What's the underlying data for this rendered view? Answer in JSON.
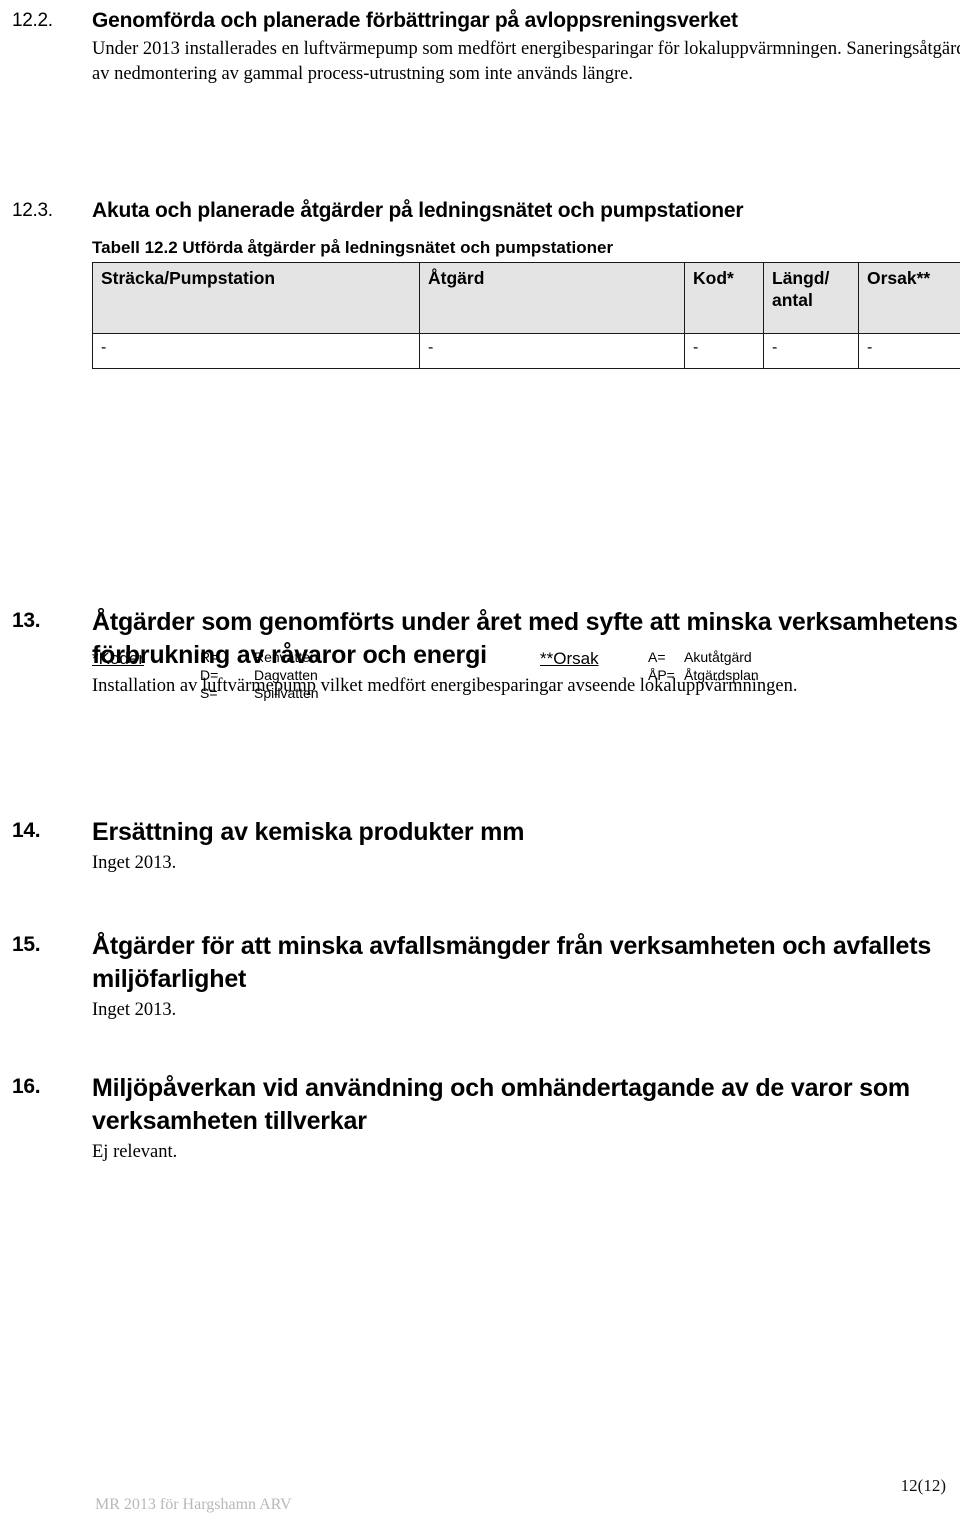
{
  "document": {
    "sections": [
      {
        "number": "12.2.",
        "title": "Genomförda och planerade förbättringar på avloppsreningsverket",
        "body": "Under 2013 installerades en luftvärmepump som medfört energibesparingar för lokaluppvärmningen. Saneringsåtgärder i form av nedmontering av gammal process-utrustning som inte används längre."
      },
      {
        "number": "12.3.",
        "title": "Akuta och planerade åtgärder på ledningsnätet och pumpstationer"
      },
      {
        "number": "13.",
        "title": "Åtgärder som genomförts under året med syfte att minska verksamhetens förbrukning av råvaror och energi",
        "body": "Installation av luftvärmepump vilket medfört energibesparingar avseende lokaluppvärmningen."
      },
      {
        "number": "14.",
        "title": "Ersättning av kemiska produkter mm",
        "body": "Inget 2013."
      },
      {
        "number": "15.",
        "title": "Åtgärder för att minska avfallsmängder från verksamheten och avfallets miljöfarlighet",
        "body": "Inget 2013."
      },
      {
        "number": "16.",
        "title": "Miljöpåverkan vid användning och omhändertagande av de varor som verksamheten tillverkar",
        "body": "Ej relevant."
      }
    ]
  },
  "table": {
    "caption": "Tabell 12.2 Utförda åtgärder på ledningsnätet och pumpstationer",
    "headers": {
      "stracka": "Sträcka/Pumpstation",
      "atgard": "Åtgärd",
      "kod": "Kod*",
      "langd": "Längd/ antal",
      "langd_line1": "Längd/",
      "langd_line2": "antal",
      "orsak": "Orsak**"
    },
    "rows": [
      {
        "stracka": "-",
        "atgard": "-",
        "kod": "-",
        "langd": "-",
        "orsak": "-"
      }
    ],
    "header_bg": "#e4e4e4",
    "border_color": "#1a1a1a"
  },
  "legend": {
    "koder": {
      "title": "*Koder",
      "items": [
        {
          "key": "R=",
          "value": "Renvatten"
        },
        {
          "key": "D=",
          "value": "Dagvatten"
        },
        {
          "key": "S=",
          "value": "Spillvatten"
        }
      ]
    },
    "orsak": {
      "title": "**Orsak",
      "items": [
        {
          "key": "A=",
          "value": "Akutåtgärd"
        },
        {
          "key": "ÅP=",
          "value": "Åtgärdsplan"
        }
      ]
    }
  },
  "footer": {
    "left": "MR 2013 för Hargshamn ARV",
    "page": "12(12)",
    "left_color": "#b8b8b8"
  }
}
